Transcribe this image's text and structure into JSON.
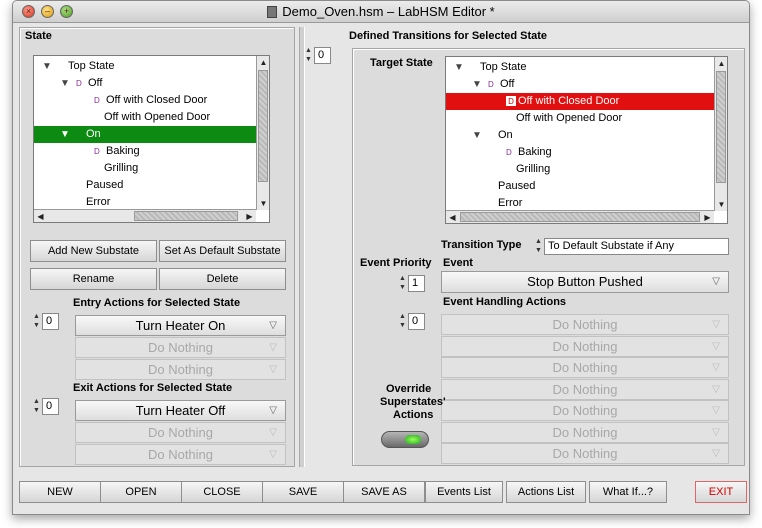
{
  "window": {
    "title": "Demo_Oven.hsm – LabHSM Editor *"
  },
  "state_panel": {
    "label": "State",
    "tree": [
      {
        "label": "Top State",
        "level": 0,
        "expanded": true,
        "d": false
      },
      {
        "label": "Off",
        "level": 1,
        "expanded": true,
        "d": true
      },
      {
        "label": "Off with Closed Door",
        "level": 2,
        "expanded": false,
        "d": true
      },
      {
        "label": "Off with Opened Door",
        "level": 2,
        "expanded": false,
        "d": false
      },
      {
        "label": "On",
        "level": 1,
        "expanded": true,
        "d": false,
        "selected": true
      },
      {
        "label": "Baking",
        "level": 2,
        "expanded": false,
        "d": true
      },
      {
        "label": "Grilling",
        "level": 2,
        "expanded": false,
        "d": false
      },
      {
        "label": "Paused",
        "level": 1,
        "expanded": false,
        "d": false
      },
      {
        "label": "Error",
        "level": 1,
        "expanded": false,
        "d": false
      }
    ],
    "buttons": {
      "add_substate": "Add New Substate",
      "set_default": "Set As Default Substate",
      "rename": "Rename",
      "delete": "Delete"
    },
    "entry": {
      "label": "Entry Actions for Selected State",
      "index": "0",
      "actions": [
        "Turn Heater On",
        "Do Nothing",
        "Do Nothing"
      ]
    },
    "exit": {
      "label": "Exit Actions for Selected State",
      "index": "0",
      "actions": [
        "Turn Heater Off",
        "Do Nothing",
        "Do Nothing"
      ]
    }
  },
  "transitions": {
    "label": "Defined Transitions for Selected State",
    "index": "0",
    "target_label": "Target State",
    "tree": [
      {
        "label": "Top State",
        "level": 0,
        "expanded": true,
        "d": false
      },
      {
        "label": "Off",
        "level": 1,
        "expanded": true,
        "d": true
      },
      {
        "label": "Off with Closed Door",
        "level": 2,
        "expanded": false,
        "d": true,
        "selected": true
      },
      {
        "label": "Off with Opened Door",
        "level": 2,
        "expanded": false,
        "d": false
      },
      {
        "label": "On",
        "level": 1,
        "expanded": true,
        "d": false
      },
      {
        "label": "Baking",
        "level": 2,
        "expanded": false,
        "d": true
      },
      {
        "label": "Grilling",
        "level": 2,
        "expanded": false,
        "d": false
      },
      {
        "label": "Paused",
        "level": 1,
        "expanded": false,
        "d": false
      },
      {
        "label": "Error",
        "level": 1,
        "expanded": false,
        "d": false
      }
    ],
    "transition_type_label": "Transition Type",
    "transition_type_value": "To Default Substate if Any",
    "event_priority_label": "Event Priority",
    "event_priority_value": "1",
    "event_label": "Event",
    "event_value": "Stop Button Pushed",
    "handling_label": "Event Handling Actions",
    "handling_index": "0",
    "handling_actions": [
      "Do Nothing",
      "Do Nothing",
      "Do Nothing",
      "Do Nothing",
      "Do Nothing",
      "Do Nothing",
      "Do Nothing"
    ],
    "override_label_1": "Override",
    "override_label_2": "Superstates'",
    "override_label_3": "Actions"
  },
  "toolbar": {
    "new": "NEW",
    "open": "OPEN",
    "close": "CLOSE",
    "save": "SAVE",
    "save_as": "SAVE AS",
    "events_list": "Events List",
    "actions_list": "Actions List",
    "what_if": "What If...?",
    "exit": "EXIT"
  },
  "colors": {
    "selected_state": "#0c8a12",
    "selected_target": "#e10f0f",
    "exit_text": "#d20000"
  }
}
